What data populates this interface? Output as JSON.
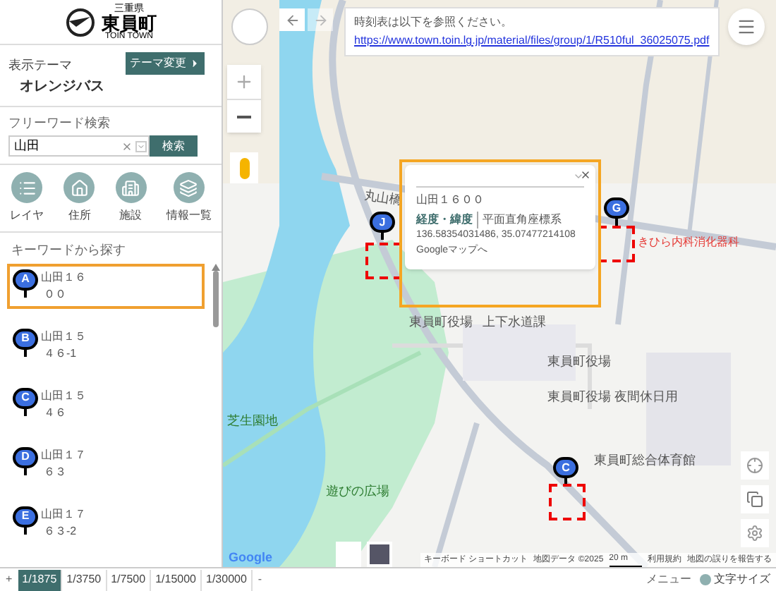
{
  "header": {
    "prefecture": "三重県",
    "town": "東員町",
    "romaji": "TOIN TOWN"
  },
  "theme": {
    "label": "表示テーマ",
    "value": "オレンジバス",
    "button": "テーマ変更"
  },
  "search": {
    "label": "フリーワード検索",
    "value": "山田",
    "button": "検索"
  },
  "nav": [
    {
      "kind": "layer",
      "label": "レイヤ"
    },
    {
      "kind": "address",
      "label": "住所"
    },
    {
      "kind": "facility",
      "label": "施設"
    },
    {
      "kind": "list",
      "label": "情報一覧"
    }
  ],
  "results": {
    "title": "キーワードから探す",
    "items": [
      {
        "marker": "A",
        "line1": "山田１６",
        "line2": "００",
        "selected": true
      },
      {
        "marker": "B",
        "line1": "山田１５",
        "line2": "４６-1",
        "selected": false
      },
      {
        "marker": "C",
        "line1": "山田１５",
        "line2": "４６",
        "selected": false
      },
      {
        "marker": "D",
        "line1": "山田１７",
        "line2": "６３",
        "selected": false
      },
      {
        "marker": "E",
        "line1": "山田１７",
        "line2": "６３-2",
        "selected": false
      }
    ]
  },
  "scale_bar": {
    "zoom_in": "+",
    "zoom_out": "-",
    "scales": [
      {
        "label": "1/1875",
        "selected": true
      },
      {
        "label": "1/3750",
        "selected": false
      },
      {
        "label": "1/7500",
        "selected": false
      },
      {
        "label": "1/15000",
        "selected": false
      },
      {
        "label": "1/30000",
        "selected": false
      }
    ]
  },
  "footer": {
    "menu": "メニュー",
    "text_size": "文字サイズ"
  },
  "notice": {
    "text": "時刻表は以下を参照ください。",
    "link": "https://www.town.toin.lg.jp/material/files/group/1/R510ful_36025075.pdf"
  },
  "popup": {
    "title": "山田１６００",
    "tabs": [
      {
        "label": "経度・緯度",
        "selected": true
      },
      {
        "label": "平面直角座標系",
        "selected": false
      }
    ],
    "coords": "136.58354031486, 35.07477214108",
    "link": "Googleマップへ"
  },
  "map_labels": [
    {
      "kind": "road",
      "text": "丸山橋"
    },
    {
      "kind": "place",
      "text": "東員町役場"
    },
    {
      "kind": "place",
      "text": "上下水道課"
    },
    {
      "kind": "clinic",
      "text": "きひら内科消化器科"
    },
    {
      "kind": "place",
      "text": "東員町役場"
    },
    {
      "kind": "place",
      "text": "東員町役場 夜間休日用"
    },
    {
      "kind": "park",
      "text": "芝生園地"
    },
    {
      "kind": "park",
      "text": "遊びの広場"
    },
    {
      "kind": "place",
      "text": "東員町総合体育館"
    }
  ],
  "map_markers": [
    "J",
    "G",
    "C"
  ],
  "attribution": {
    "logo": "Google",
    "shortcuts": "キーボード ショートカット",
    "data": "地図データ ©2025",
    "scale": "20 m",
    "terms": "利用規約",
    "report": "地図の誤りを報告する"
  }
}
